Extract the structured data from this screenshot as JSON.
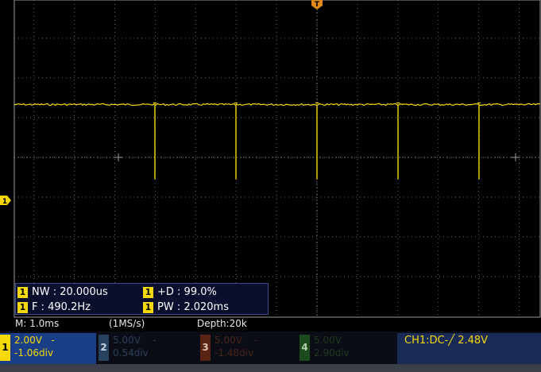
{
  "colors": {
    "ch1": "#f5d90a",
    "grid": "#6a6a6a",
    "panel_bg": "#0a0f2e",
    "trigger_panel": "#182a55"
  },
  "markers": {
    "trigger_top": "T",
    "ch1_level": "1"
  },
  "measurements": {
    "nw": {
      "ch": "1",
      "text": "NW : 20.000us"
    },
    "duty": {
      "ch": "1",
      "text": "+D : 99.0%"
    },
    "freq": {
      "ch": "1",
      "text": "F : 490.2Hz"
    },
    "pw": {
      "ch": "1",
      "text": "PW : 2.020ms"
    }
  },
  "status": {
    "timebase": "M: 1.0ms",
    "sample_rate": "(1MS/s)",
    "depth": "Depth:20k"
  },
  "channels": [
    {
      "num": "1",
      "volts": "2.00V",
      "coupling": "-",
      "offset": "-1.06div"
    },
    {
      "num": "2",
      "volts": "5.00V",
      "coupling": "-",
      "offset": "0.54div"
    },
    {
      "num": "3",
      "volts": "5.00V",
      "coupling": "-",
      "offset": "-1.48div"
    },
    {
      "num": "4",
      "volts": "5.00V",
      "coupling": "",
      "offset": "2.90div"
    }
  ],
  "trigger": {
    "text": "CH1:DC-╱ 2.48V"
  },
  "chart_data": {
    "type": "line",
    "series": [
      {
        "name": "1",
        "high_level_div": 1.33,
        "low_level_div": -0.55,
        "pulse_times_ms": [
          -2.0,
          -1.0,
          0.0,
          1.0,
          2.0
        ]
      }
    ],
    "x_divisions": 14,
    "y_divisions": 8,
    "grid": true
  }
}
